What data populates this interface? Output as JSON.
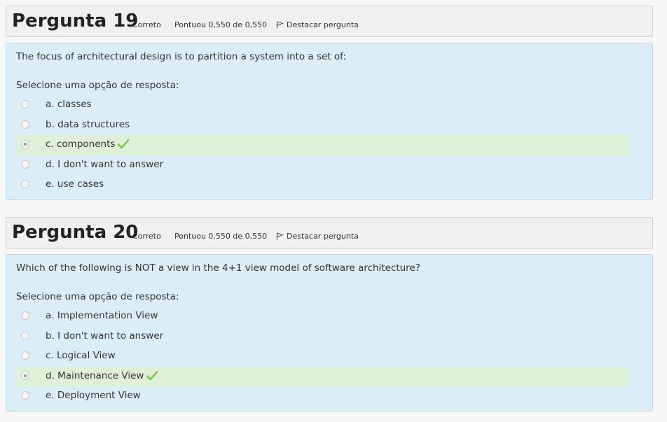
{
  "questions": [
    {
      "title_prefix": "Pergunta",
      "number": "19",
      "state": "Correto",
      "grade": "Pontuou 0,550 de 0,550",
      "flag_label": "Destacar pergunta",
      "text": "The focus of architectural design is to partition a system into a set of:",
      "prompt": "Selecione uma opção de resposta:",
      "options": [
        {
          "label": "a. classes",
          "selected": false
        },
        {
          "label": "b. data structures",
          "selected": false
        },
        {
          "label": "c. components",
          "selected": true
        },
        {
          "label": "d. I don't want to answer",
          "selected": false
        },
        {
          "label": "e. use cases",
          "selected": false
        }
      ]
    },
    {
      "title_prefix": "Pergunta",
      "number": "20",
      "state": "Correto",
      "grade": "Pontuou 0,550 de 0,550",
      "flag_label": "Destacar pergunta",
      "text": "Which of the following is NOT a view in the 4+1 view model of software architecture?",
      "prompt": "Selecione uma opção de resposta:",
      "options": [
        {
          "label": "a. Implementation View",
          "selected": false
        },
        {
          "label": "b. I don't want to answer",
          "selected": false
        },
        {
          "label": "c. Logical View",
          "selected": false
        },
        {
          "label": "d. Maintenance View",
          "selected": true
        },
        {
          "label": "e. Deployment View",
          "selected": false
        }
      ]
    }
  ],
  "colors": {
    "content_bg": "#dbedf6",
    "correct_bg": "#dff0d8",
    "check": "#7cc243"
  },
  "icons": {
    "flag": "flag-icon",
    "correct": "check-icon"
  }
}
